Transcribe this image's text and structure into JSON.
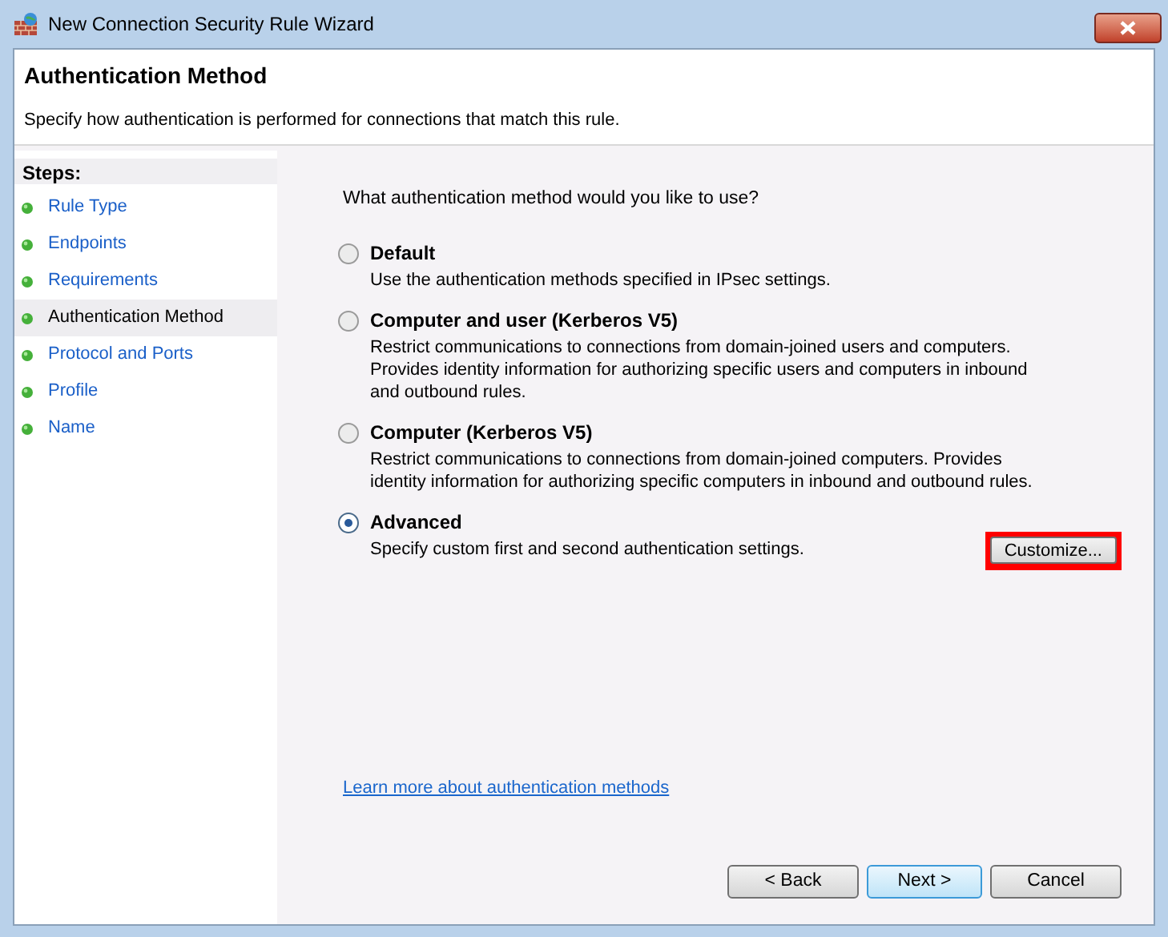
{
  "window": {
    "title": "New Connection Security Rule Wizard"
  },
  "header": {
    "title": "Authentication Method",
    "description": "Specify how authentication is performed for connections that match this rule."
  },
  "steps": {
    "heading": "Steps:",
    "items": [
      {
        "label": "Rule Type",
        "selected": false
      },
      {
        "label": "Endpoints",
        "selected": false
      },
      {
        "label": "Requirements",
        "selected": false
      },
      {
        "label": "Authentication Method",
        "selected": true
      },
      {
        "label": "Protocol and Ports",
        "selected": false
      },
      {
        "label": "Profile",
        "selected": false
      },
      {
        "label": "Name",
        "selected": false
      }
    ]
  },
  "question": "What authentication method would you like to use?",
  "options": [
    {
      "label": "Default",
      "description": "Use the authentication methods specified in IPsec settings.",
      "selected": false
    },
    {
      "label": "Computer and user (Kerberos V5)",
      "description": "Restrict communications to connections from domain-joined users and computers. Provides identity information for authorizing specific users and computers in inbound and outbound rules.",
      "selected": false
    },
    {
      "label": "Computer (Kerberos V5)",
      "description": "Restrict communications to connections from domain-joined computers.  Provides identity information for authorizing specific computers in inbound and outbound rules.",
      "selected": false
    },
    {
      "label": "Advanced",
      "description": "Specify custom first and second authentication settings.",
      "selected": true,
      "button": {
        "label": "Customize...",
        "highlighted": true
      }
    }
  ],
  "link": "Learn more about authentication methods",
  "buttons": [
    {
      "label": "< Back",
      "default": false
    },
    {
      "label": "Next >",
      "default": true
    },
    {
      "label": "Cancel",
      "default": false
    }
  ]
}
